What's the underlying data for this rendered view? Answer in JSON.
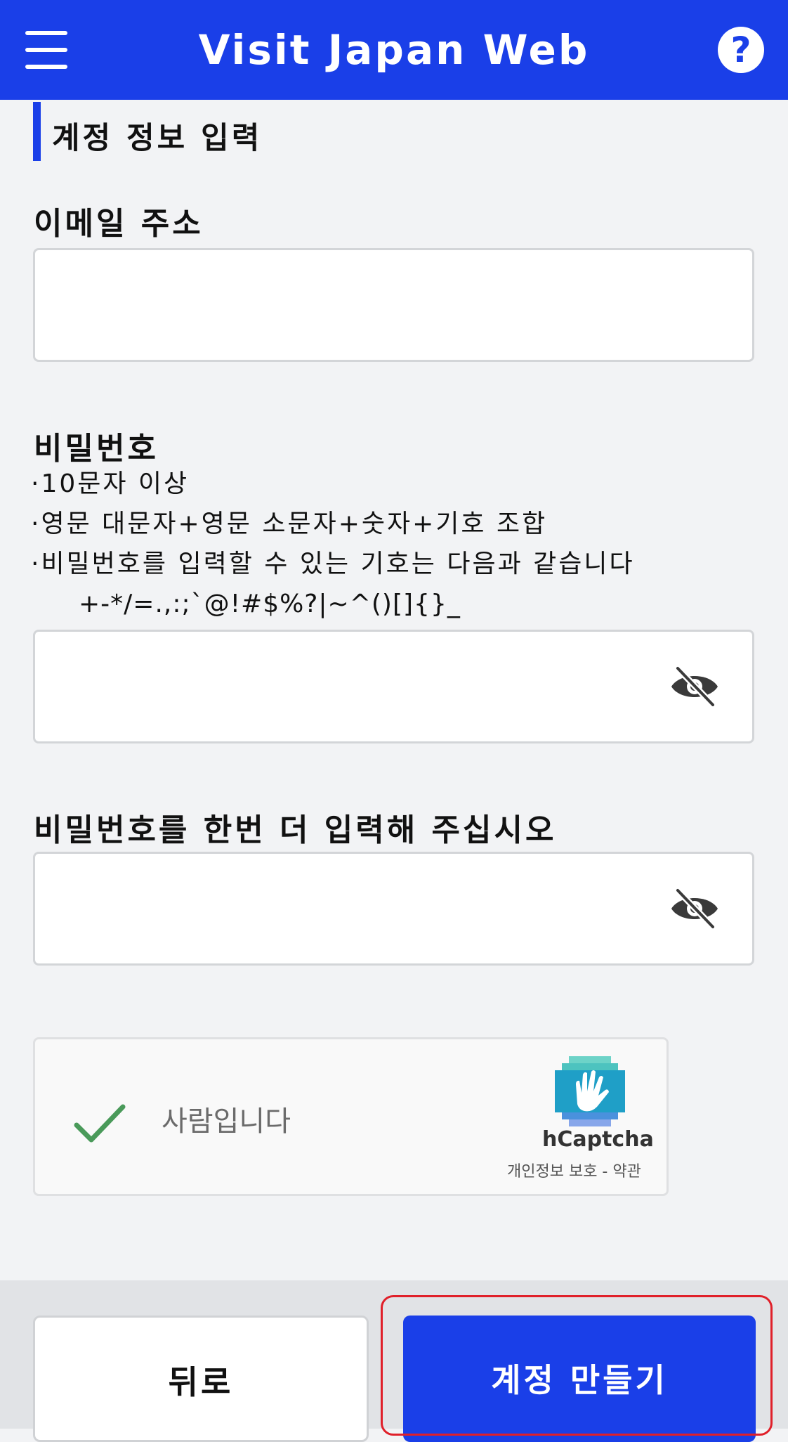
{
  "header": {
    "title": "Visit Japan Web",
    "menu_icon": "hamburger-menu-icon",
    "help_icon": "question-circle-icon",
    "help_glyph": "?",
    "accent_color": "#1a3fe8"
  },
  "section": {
    "title": "계정 정보 입력"
  },
  "email": {
    "label": "이메일 주소",
    "value": "",
    "placeholder": ""
  },
  "password": {
    "label": "비밀번호",
    "rules": [
      "·10문자 이상",
      "·영문 대문자+영문 소문자+숫자+기호 조합",
      "·비밀번호를 입력할 수 있는 기호는 다음과 같습니다"
    ],
    "symbols": "+-*/=.,:;`@!#$%?|~^()[]{}_",
    "value": "",
    "toggle_icon": "eye-slash-icon"
  },
  "password_confirm": {
    "label": "비밀번호를 한번 더 입력해 주십시오",
    "value": "",
    "toggle_icon": "eye-slash-icon"
  },
  "captcha": {
    "status_text": "사람입니다",
    "brand": "hCaptcha",
    "links": "개인정보 보호 - 약관",
    "check_icon": "checkmark-icon",
    "check_color": "#4a9a5a"
  },
  "footer": {
    "back_label": "뒤로",
    "create_label": "계정 만들기",
    "highlight_color": "#e0202a"
  }
}
